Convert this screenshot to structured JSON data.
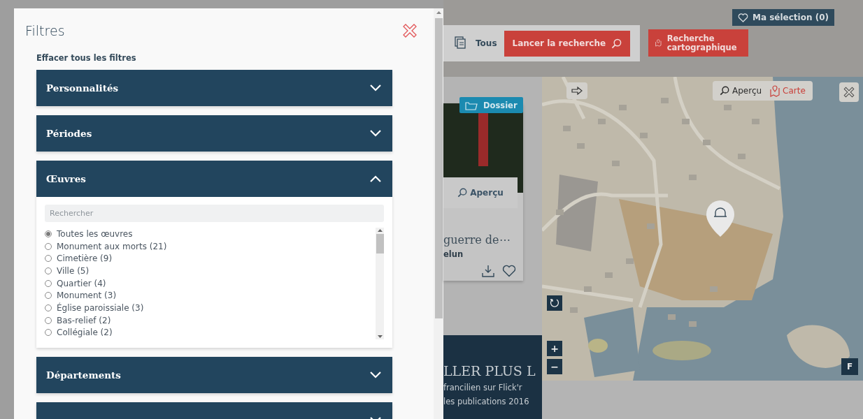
{
  "modal": {
    "title": "Filtres",
    "clear_all": "Effacer tous les filtres",
    "sections": [
      {
        "label": "Personnalités",
        "expanded": false
      },
      {
        "label": "Périodes",
        "expanded": false
      },
      {
        "label": "Œuvres",
        "expanded": true,
        "search": {
          "placeholder": "Rechercher"
        },
        "options": [
          {
            "label": "Toutes les œuvres",
            "selected": true
          },
          {
            "label": "Monument aux morts (21)",
            "selected": false
          },
          {
            "label": "Cimetière (9)",
            "selected": false
          },
          {
            "label": "Ville (5)",
            "selected": false
          },
          {
            "label": "Quartier (4)",
            "selected": false
          },
          {
            "label": "Monument (3)",
            "selected": false
          },
          {
            "label": "Église paroissiale (3)",
            "selected": false
          },
          {
            "label": "Bas-relief (2)",
            "selected": false
          },
          {
            "label": "Collégiale (2)",
            "selected": false
          }
        ]
      },
      {
        "label": "Départements",
        "expanded": false
      },
      {
        "expanded": false
      }
    ]
  },
  "header": {
    "selection": "Ma sélection (0)",
    "scope": "Tous",
    "search_button": "Lancer la recherche",
    "map_search_button": "Recherche cartographique"
  },
  "result_card": {
    "badge": "Dossier",
    "preview": "Aperçu",
    "title": "guerre de⋯",
    "subtitle": "elun"
  },
  "promo": {
    "heading": "LLER PLUS L",
    "lines": [
      "francilien sur Flick'r",
      "les publications 2016"
    ]
  },
  "map": {
    "views": [
      {
        "label": "Aperçu",
        "selected": false
      },
      {
        "label": "Carte",
        "selected": true
      }
    ],
    "fullscreen": "F",
    "zoom_in": "+",
    "zoom_out": "−"
  }
}
